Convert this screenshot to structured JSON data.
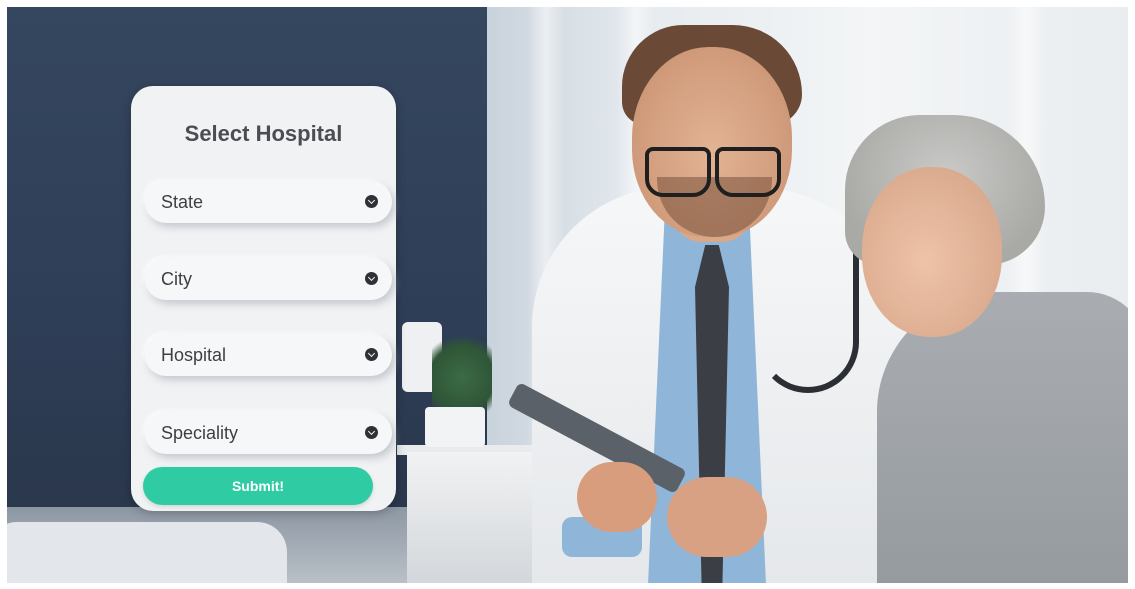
{
  "form": {
    "title": "Select Hospital",
    "fields": [
      {
        "label": "State"
      },
      {
        "label": "City"
      },
      {
        "label": "Hospital"
      },
      {
        "label": "Speciality"
      }
    ],
    "submit_label": "Submit!"
  },
  "colors": {
    "accent": "#2fcca4",
    "card_bg": "#f1f2f4",
    "text": "#3d3f44"
  },
  "icons": {
    "dropdown": "chevron-down-circle-icon"
  }
}
